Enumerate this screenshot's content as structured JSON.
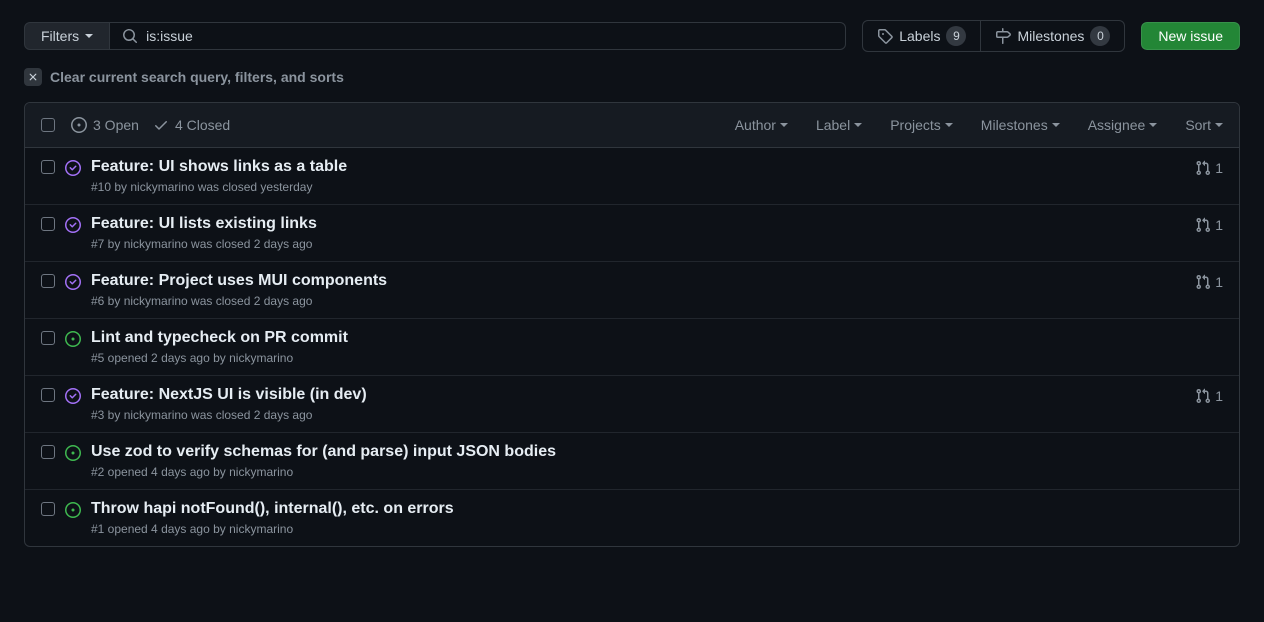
{
  "filters": {
    "label": "Filters"
  },
  "search": {
    "value": "is:issue"
  },
  "labels_btn": {
    "label": "Labels",
    "count": "9"
  },
  "milestones_btn": {
    "label": "Milestones",
    "count": "0"
  },
  "new_issue": {
    "label": "New issue"
  },
  "clear": {
    "label": "Clear current search query, filters, and sorts"
  },
  "header": {
    "open": "3 Open",
    "closed": "4 Closed",
    "filters": [
      "Author",
      "Label",
      "Projects",
      "Milestones",
      "Assignee",
      "Sort"
    ]
  },
  "issues": [
    {
      "state": "closed",
      "title": "Feature: UI shows links as a table",
      "meta": "#10 by nickymarino was closed yesterday",
      "pr_count": "1"
    },
    {
      "state": "closed",
      "title": "Feature: UI lists existing links",
      "meta": "#7 by nickymarino was closed 2 days ago",
      "pr_count": "1"
    },
    {
      "state": "closed",
      "title": "Feature: Project uses MUI components",
      "meta": "#6 by nickymarino was closed 2 days ago",
      "pr_count": "1"
    },
    {
      "state": "open",
      "title": "Lint and typecheck on PR commit",
      "meta": "#5 opened 2 days ago by nickymarino",
      "pr_count": ""
    },
    {
      "state": "closed",
      "title": "Feature: NextJS UI is visible (in dev)",
      "meta": "#3 by nickymarino was closed 2 days ago",
      "pr_count": "1"
    },
    {
      "state": "open",
      "title": "Use zod to verify schemas for (and parse) input JSON bodies",
      "meta": "#2 opened 4 days ago by nickymarino",
      "pr_count": ""
    },
    {
      "state": "open",
      "title": "Throw hapi notFound(), internal(), etc. on errors",
      "meta": "#1 opened 4 days ago by nickymarino",
      "pr_count": ""
    }
  ]
}
